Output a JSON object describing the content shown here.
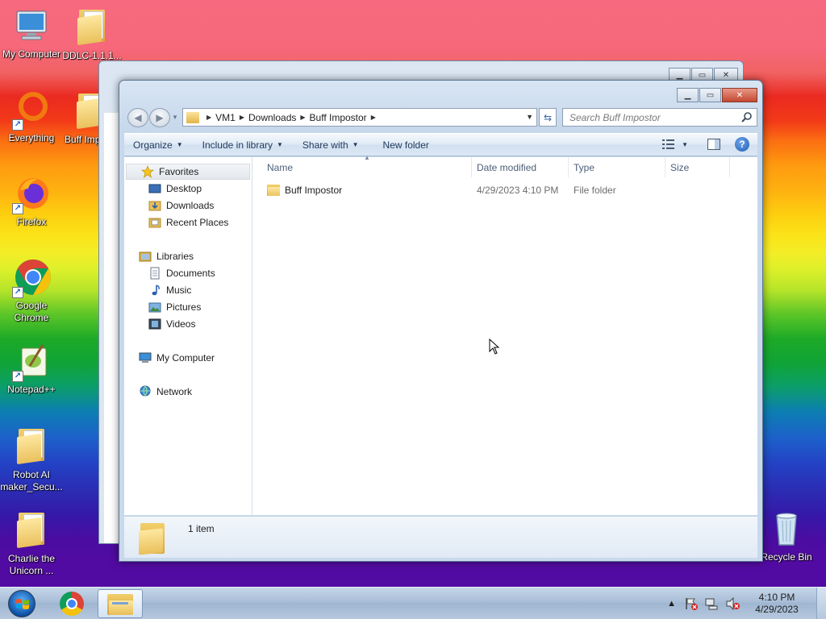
{
  "desktop": {
    "icons": [
      {
        "label": "My Computer",
        "icon": "computer-icon"
      },
      {
        "label": "DDLC-1.1.1...",
        "icon": "folder-icon"
      },
      {
        "label": "Everything",
        "icon": "everything-icon"
      },
      {
        "label": "Buff Imp...",
        "icon": "folder-icon"
      },
      {
        "label": "Firefox",
        "icon": "firefox-icon"
      },
      {
        "label": "Google Chrome",
        "icon": "chrome-icon"
      },
      {
        "label": "Notepad++",
        "icon": "notepad-plus-plus-icon"
      },
      {
        "label": "Robot AI maker_Secu...",
        "icon": "folder-icon"
      },
      {
        "label": "Charlie the Unicorn ...",
        "icon": "folder-icon"
      },
      {
        "label": "Recycle Bin",
        "icon": "recycle-bin-icon"
      }
    ]
  },
  "explorer": {
    "breadcrumb": [
      "VM1",
      "Downloads",
      "Buff Impostor"
    ],
    "search_placeholder": "Search Buff Impostor",
    "toolbar": {
      "organize": "Organize",
      "include_in_library": "Include in library",
      "share_with": "Share with",
      "new_folder": "New folder"
    },
    "nav": {
      "favorites": "Favorites",
      "desktop": "Desktop",
      "downloads": "Downloads",
      "recent_places": "Recent Places",
      "libraries": "Libraries",
      "documents": "Documents",
      "music": "Music",
      "pictures": "Pictures",
      "videos": "Videos",
      "my_computer": "My Computer",
      "network": "Network"
    },
    "columns": {
      "name": "Name",
      "date_modified": "Date modified",
      "type": "Type",
      "size": "Size"
    },
    "files": [
      {
        "name": "Buff Impostor",
        "date_modified": "4/29/2023 4:10 PM",
        "type": "File folder",
        "size": ""
      }
    ],
    "status": {
      "item_count": "1 item"
    }
  },
  "taskbar": {
    "clock_time": "4:10 PM",
    "clock_date": "4/29/2023",
    "tray_up": "▲"
  }
}
